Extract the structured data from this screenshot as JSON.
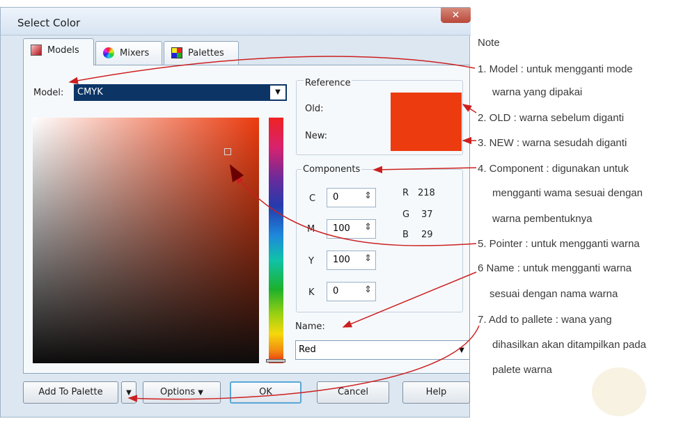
{
  "dialog": {
    "title": "Select Color",
    "close_symbol": "✕",
    "tabs": [
      {
        "label": "Models",
        "icon": "models-icon"
      },
      {
        "label": "Mixers",
        "icon": "mixers-icon"
      },
      {
        "label": "Palettes",
        "icon": "palettes-icon"
      }
    ],
    "model_label": "Model:",
    "model_value": "CMYK",
    "reference": {
      "label": "Reference",
      "old_label": "Old:",
      "new_label": "New:",
      "old_color": "#ec3b0e",
      "new_color": "#ec3b0e"
    },
    "components": {
      "label": "Components",
      "fields": [
        {
          "name": "C",
          "value": "0"
        },
        {
          "name": "M",
          "value": "100"
        },
        {
          "name": "Y",
          "value": "100"
        },
        {
          "name": "K",
          "value": "0"
        }
      ],
      "rgb": [
        {
          "name": "R",
          "value": "218"
        },
        {
          "name": "G",
          "value": "37"
        },
        {
          "name": "B",
          "value": "29"
        }
      ]
    },
    "name_label": "Name:",
    "name_value": "Red",
    "buttons": {
      "add_to_palette": "Add To Palette",
      "options": "Options",
      "ok": "OK",
      "cancel": "Cancel",
      "help": "Help"
    },
    "colors": {
      "accent": "#ec3b0e",
      "arrow": "#cc1f1f"
    }
  },
  "notes": {
    "heading": "Note",
    "lines": [
      "1. Model : untuk mengganti mode",
      "warna yang dipakai",
      "2. OLD : warna sebelum diganti",
      "3. NEW : warna sesudah diganti",
      "4. Component : digunakan untuk",
      "mengganti wama sesuai dengan",
      "warna pembentuknya",
      "5. Pointer : untuk mengganti warna",
      "6 Name : untuk mengganti warna",
      "sesuai dengan nama warna",
      "7. Add to pallete : wana yang",
      "dihasilkan akan ditampilkan pada",
      "palete warna"
    ]
  }
}
